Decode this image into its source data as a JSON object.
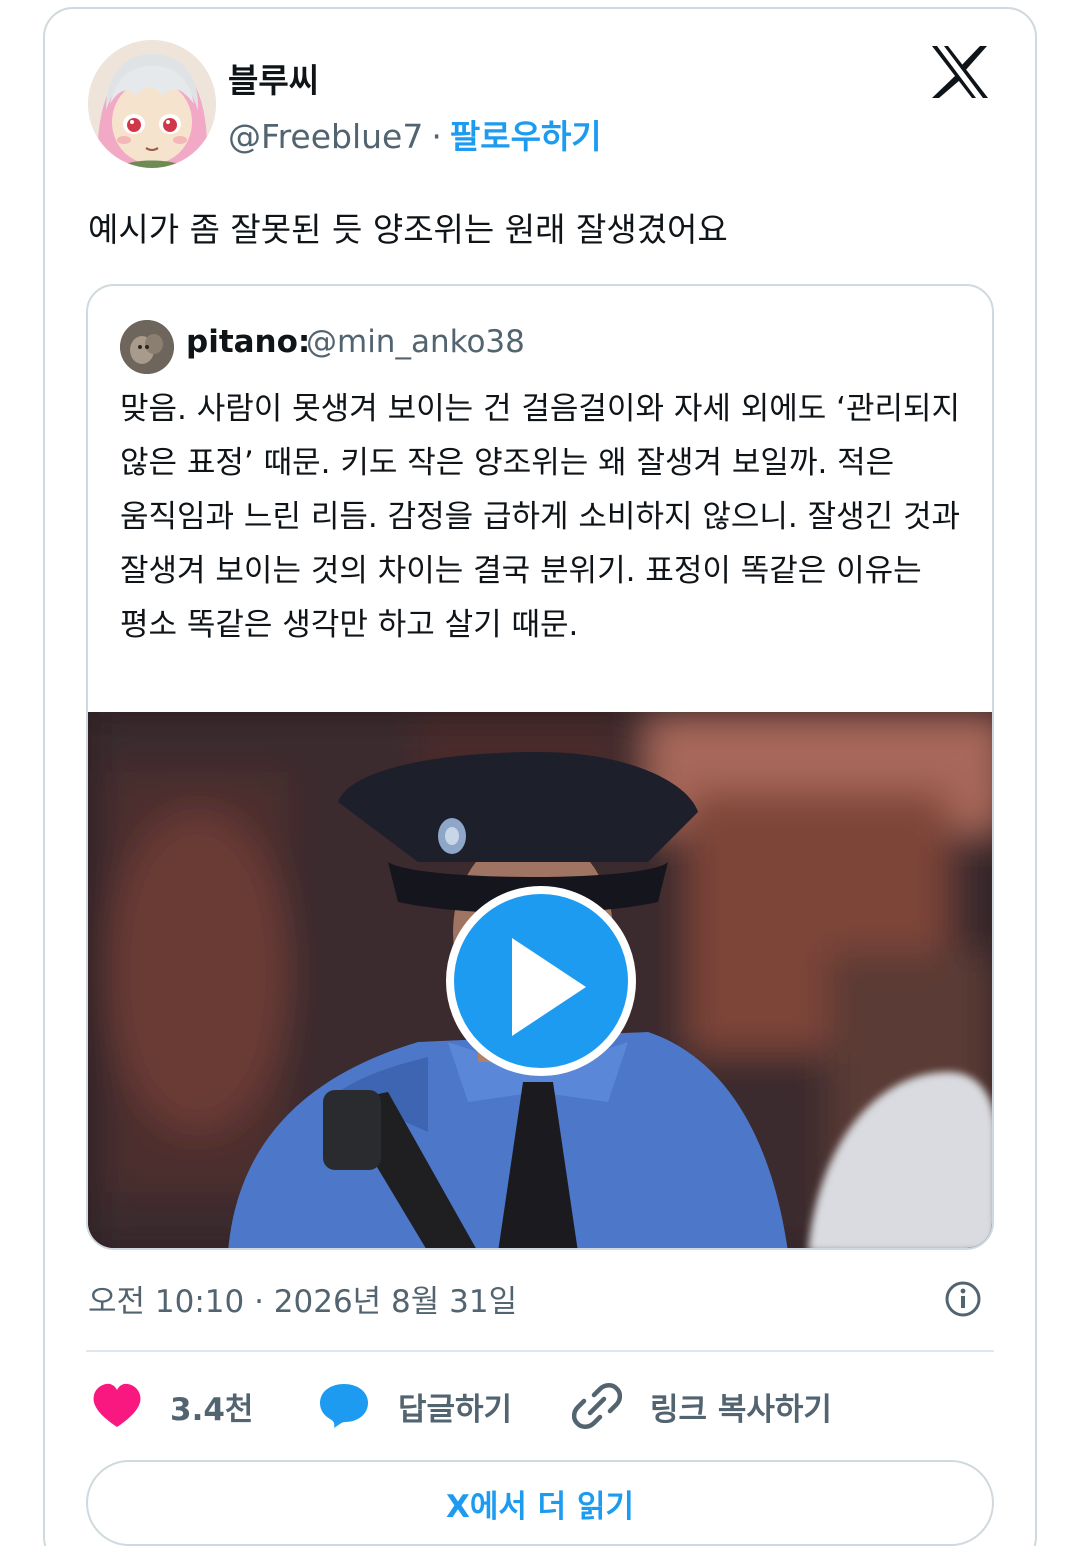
{
  "author": {
    "display_name": "블루씨",
    "handle": "@Freeblue7",
    "separator": "·",
    "follow_label": "팔로우하기"
  },
  "tweet": {
    "text": "예시가 좀 잘못된 듯 양조위는 원래 잘생겼어요",
    "timestamp": "오전 10:10 · 2026년 8월 31일"
  },
  "quote": {
    "name": "pitano:",
    "handle": "@min_anko38",
    "text": "맞음. 사람이 못생겨 보이는 건 걸음걸이와 자세 외에도 ‘관리되지 않은 표정’ 때문. 키도 작은 양조위는 왜 잘생겨 보일까. 적은 움직임과 느린 리듬. 감정을 급하게 소비하지 않으니. 잘생긴 것과 잘생겨 보이는 것의 차이는 결국 분위기. 표정이 똑같은 이유는 평소 똑같은 생각만 하고 살기 때문."
  },
  "actions": {
    "likes": "3.4천",
    "reply_label": "답글하기",
    "copy_link_label": "링크 복사하기"
  },
  "read_more_label": "X에서 더 읽기",
  "colors": {
    "accent": "#1d9bf0",
    "like": "#f91880",
    "muted": "#536471",
    "border": "#cfd9de"
  },
  "icons": [
    "x-logo-icon",
    "info-icon",
    "heart-icon",
    "reply-bubble-icon",
    "link-icon",
    "play-icon"
  ]
}
